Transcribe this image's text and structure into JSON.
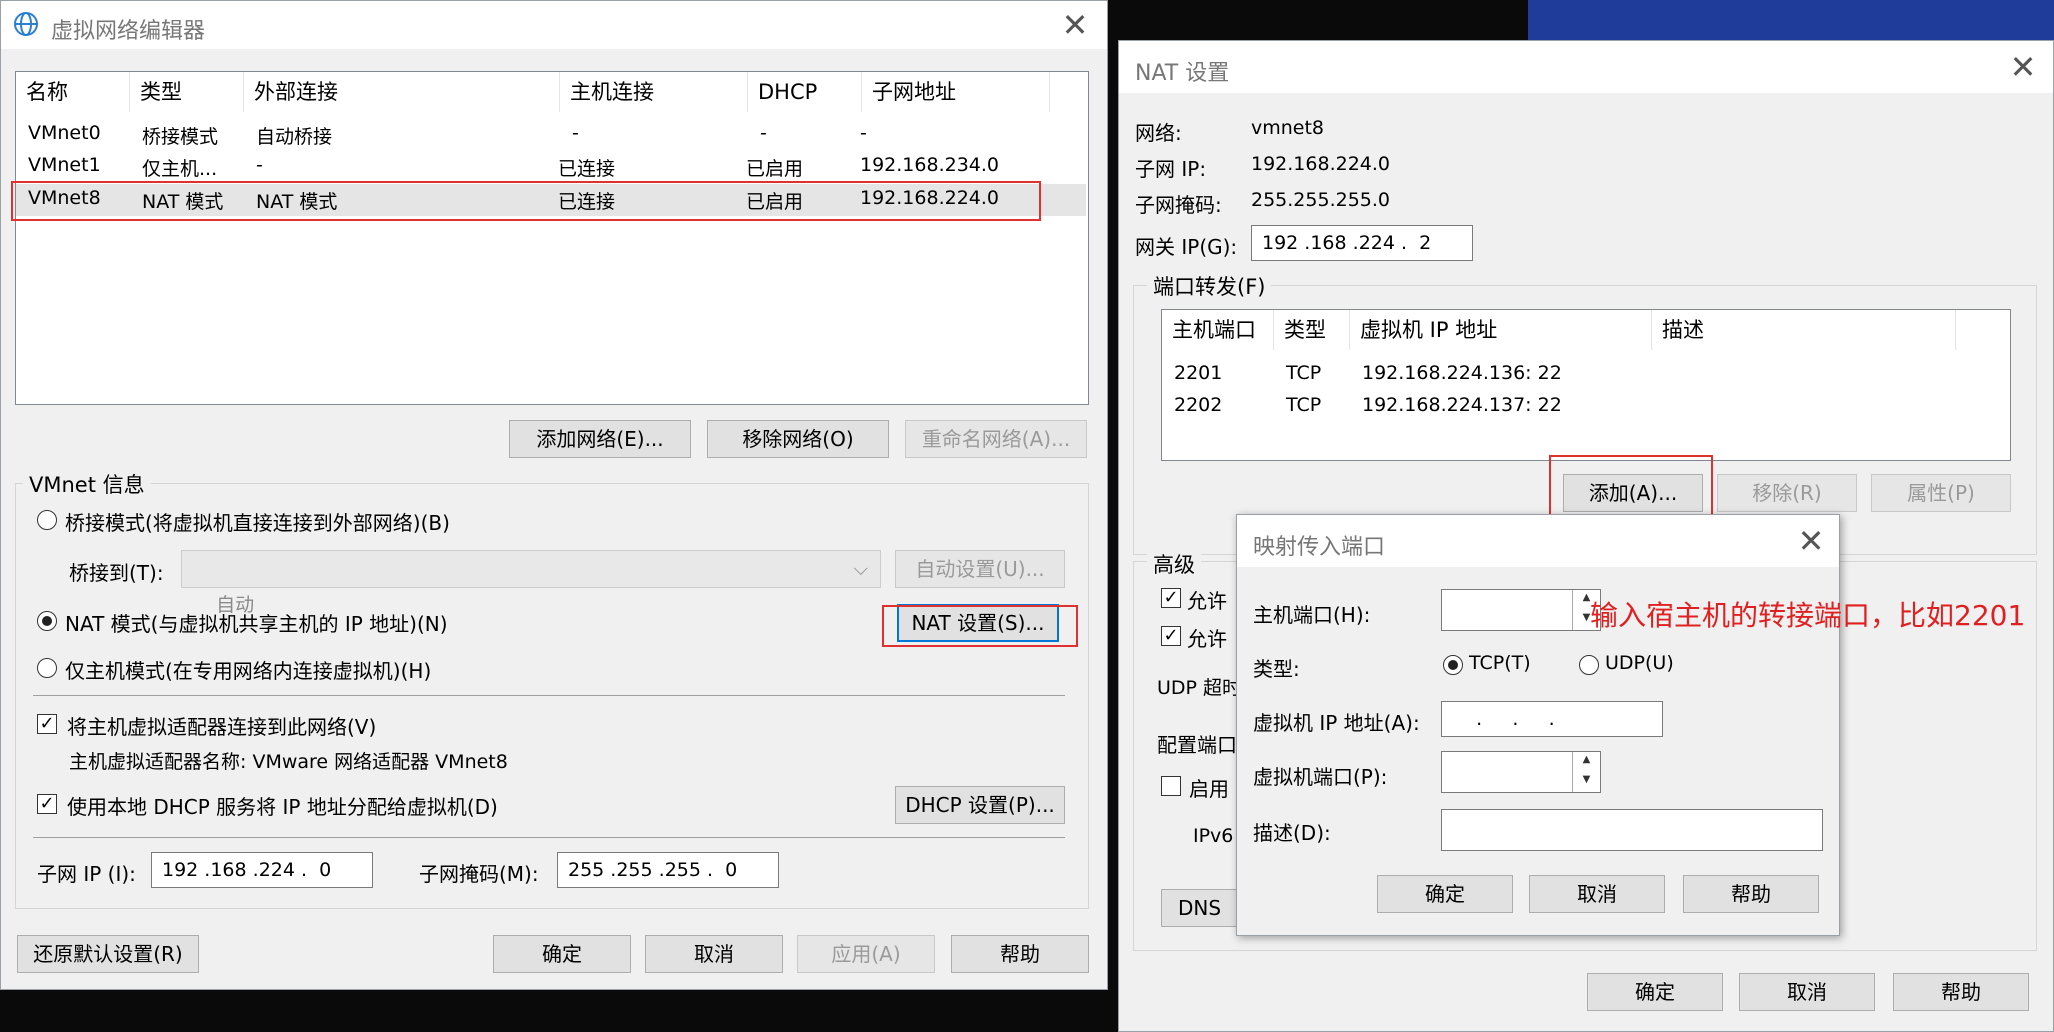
{
  "main": {
    "title": "虚拟网络编辑器",
    "columns": [
      "名称",
      "类型",
      "外部连接",
      "主机连接",
      "DHCP",
      "子网地址"
    ],
    "rows": [
      [
        "VMnet0",
        "桥接模式",
        "自动桥接",
        "-",
        "-",
        "-"
      ],
      [
        "VMnet1",
        "仅主机...",
        "-",
        "已连接",
        "已启用",
        "192.168.234.0"
      ],
      [
        "VMnet8",
        "NAT 模式",
        "NAT 模式",
        "已连接",
        "已启用",
        "192.168.224.0"
      ]
    ],
    "add_network": "添加网络(E)...",
    "remove_network": "移除网络(O)",
    "rename_network": "重命名网络(A)...",
    "vmnet_info": "VMnet 信息",
    "bridge_mode": "桥接模式(将虚拟机直接连接到外部网络)(B)",
    "bridge_to": "桥接到(T):",
    "bridge_to_value": "自动",
    "auto_settings": "自动设置(U)...",
    "nat_mode": "NAT 模式(与虚拟机共享主机的 IP 地址)(N)",
    "nat_settings": "NAT 设置(S)...",
    "host_only": "仅主机模式(在专用网络内连接虚拟机)(H)",
    "connect_adapter": "将主机虚拟适配器连接到此网络(V)",
    "adapter_name": "主机虚拟适配器名称: VMware 网络适配器 VMnet8",
    "use_dhcp": "使用本地 DHCP 服务将 IP 地址分配给虚拟机(D)",
    "dhcp_settings": "DHCP 设置(P)...",
    "subnet_ip_label": "子网 IP (I):",
    "subnet_ip": "192 .168 .224 .  0",
    "subnet_mask_label": "子网掩码(M):",
    "subnet_mask": "255 .255 .255 .  0",
    "restore_defaults": "还原默认设置(R)",
    "ok": "确定",
    "cancel": "取消",
    "apply": "应用(A)",
    "help": "帮助"
  },
  "nat": {
    "title": "NAT 设置",
    "network_label": "网络:",
    "network": "vmnet8",
    "subnet_ip_label": "子网 IP:",
    "subnet_ip": "192.168.224.0",
    "subnet_mask_label": "子网掩码:",
    "subnet_mask": "255.255.255.0",
    "gateway_label": "网关 IP(G):",
    "gateway": "192 .168 .224 .  2",
    "port_forwarding": "端口转发(F)",
    "columns": [
      "主机端口",
      "类型",
      "虚拟机 IP 地址",
      "描述"
    ],
    "rows": [
      [
        "2201",
        "TCP",
        "192.168.224.136: 22",
        ""
      ],
      [
        "2202",
        "TCP",
        "192.168.224.137: 22",
        ""
      ]
    ],
    "add": "添加(A)...",
    "remove": "移除(R)",
    "properties": "属性(P)",
    "advanced": "高级",
    "allow1": "允许",
    "allow2": "允许",
    "udp_timeout": "UDP 超时",
    "config_port": "配置端口",
    "enable": "启用",
    "ipv6": "IPv6",
    "dns": "DNS",
    "ok": "确定",
    "cancel": "取消",
    "help": "帮助"
  },
  "map": {
    "title": "映射传入端口",
    "host_port_label": "主机端口(H):",
    "type_label": "类型:",
    "tcp": "TCP(T)",
    "udp": "UDP(U)",
    "vm_ip_label": "虚拟机 IP 地址(A):",
    "vm_ip": "    .     .     .",
    "vm_port_label": "虚拟机端口(P):",
    "desc_label": "描述(D):",
    "ok": "确定",
    "cancel": "取消",
    "help": "帮助"
  },
  "annotation": "输入宿主机的转接端口，比如2201",
  "colors": {
    "highlight_red": "#e03030",
    "annotation_red": "#e02020",
    "background": "#0a0a0a",
    "dialog_bg": "#f0f0f0",
    "wallpaper_blue": "#1f3c9a"
  }
}
